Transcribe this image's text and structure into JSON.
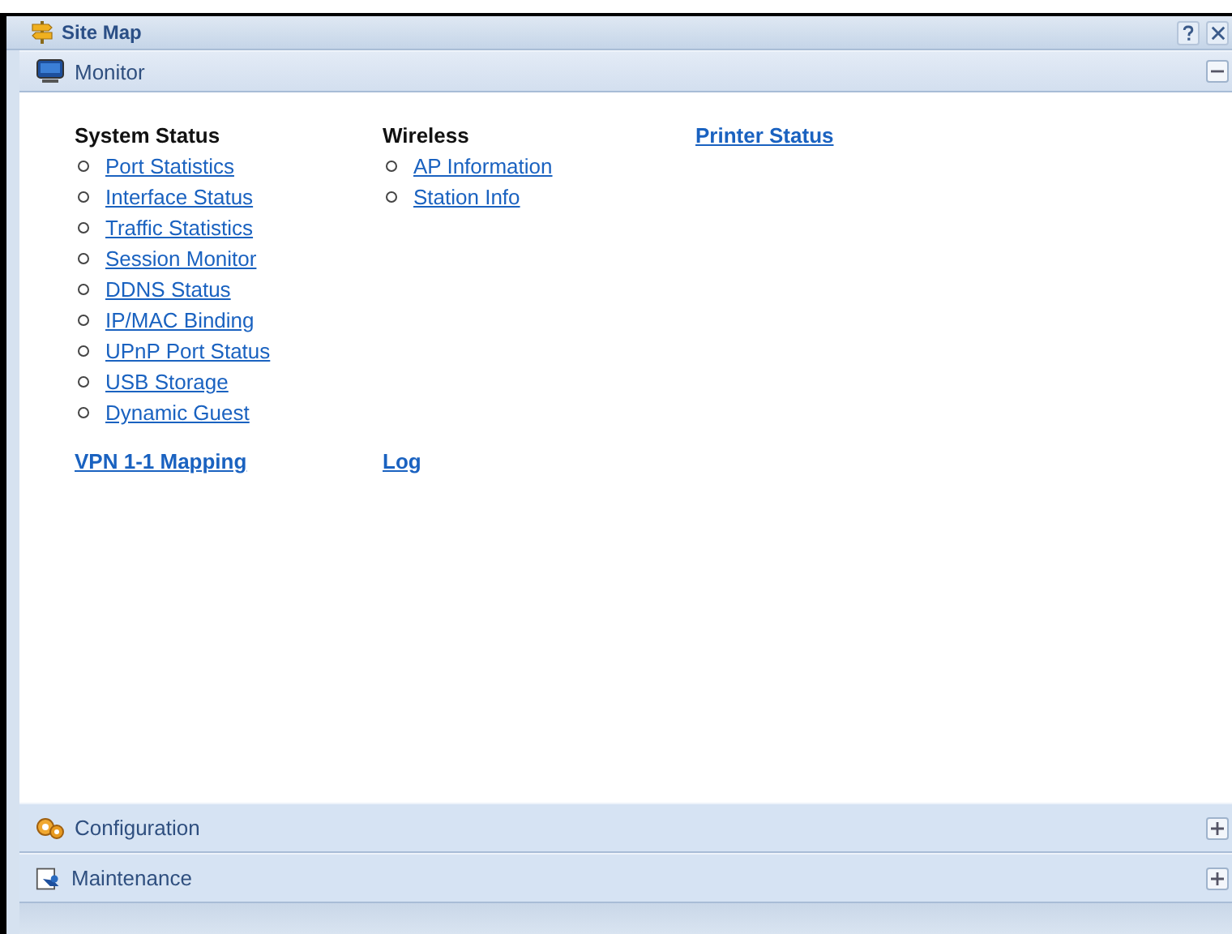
{
  "window": {
    "title": "Site Map"
  },
  "panels": [
    {
      "title": "Monitor",
      "kind": "monitor",
      "expanded": true,
      "groups": [
        {
          "kind": "heading",
          "title": "System Status",
          "items": [
            "Port Statistics",
            "Interface Status",
            "Traffic Statistics",
            "Session Monitor",
            "DDNS Status",
            "IP/MAC Binding",
            "UPnP Port Status",
            "USB Storage",
            "Dynamic Guest"
          ]
        },
        {
          "kind": "heading",
          "title": "Wireless",
          "items": [
            "AP Information",
            "Station Info"
          ]
        },
        {
          "kind": "link",
          "title": "Printer Status"
        },
        {
          "kind": "link",
          "title": "VPN 1-1 Mapping"
        },
        {
          "kind": "link",
          "title": "Log"
        }
      ]
    },
    {
      "title": "Configuration",
      "kind": "configuration",
      "expanded": false
    },
    {
      "title": "Maintenance",
      "kind": "maintenance",
      "expanded": false
    }
  ]
}
